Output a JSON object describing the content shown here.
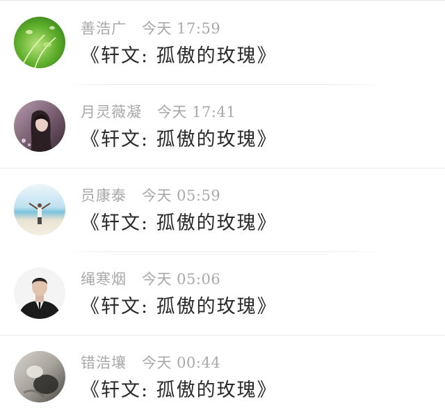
{
  "feed": {
    "items": [
      {
        "author": "善浩广",
        "time": "今天 17:59",
        "title": "《轩文: 孤傲的玫瑰》",
        "avatar": "green-plant-avatar"
      },
      {
        "author": "月灵薇凝",
        "time": "今天 17:41",
        "title": "《轩文: 孤傲的玫瑰》",
        "avatar": "girl-portrait-avatar"
      },
      {
        "author": "员康泰",
        "time": "今天 05:59",
        "title": "《轩文: 孤傲的玫瑰》",
        "avatar": "beach-person-avatar"
      },
      {
        "author": "绳寒烟",
        "time": "今天 05:06",
        "title": "《轩文: 孤傲的玫瑰》",
        "avatar": "man-in-suit-avatar"
      },
      {
        "author": "错浩壤",
        "time": "今天 00:44",
        "title": "《轩文: 孤傲的玫瑰》",
        "avatar": "blurry-photo-avatar"
      }
    ]
  }
}
